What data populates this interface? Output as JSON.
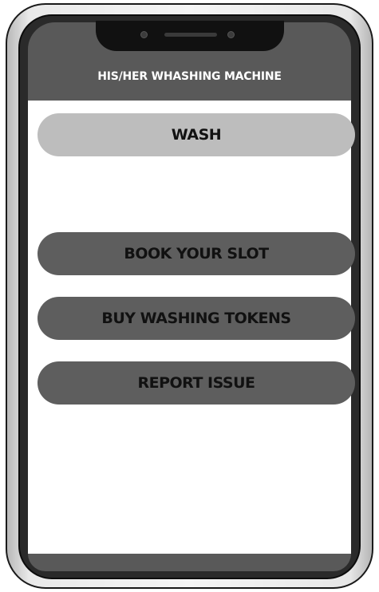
{
  "app": {
    "title": "HIS/HER WHASHING MACHINE"
  },
  "actions": {
    "wash_label": "WASH",
    "book_slot_label": "BOOK YOUR SLOT",
    "buy_tokens_label": "BUY WASHING TOKENS",
    "report_issue_label": "REPORT ISSUE"
  },
  "colors": {
    "header": "#595959",
    "primary_button": "#bdbdbd",
    "secondary_button": "#5e5e5e",
    "screen_background": "#ffffff"
  }
}
